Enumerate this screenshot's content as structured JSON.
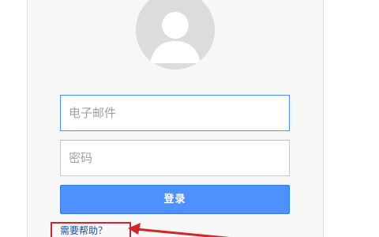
{
  "login": {
    "email_placeholder": "电子邮件",
    "password_placeholder": "密码",
    "signin_label": "登录",
    "help_link": "需要帮助？"
  },
  "icons": {
    "avatar": "default-user-avatar-icon",
    "annotation": "red-arrow-annotation"
  },
  "colors": {
    "button_blue": "#4d90fe",
    "focus_border": "#4d90fe",
    "link": "#1c4fa0",
    "annotation_red": "#d2262b",
    "avatar_bg": "#dcdcdc"
  }
}
